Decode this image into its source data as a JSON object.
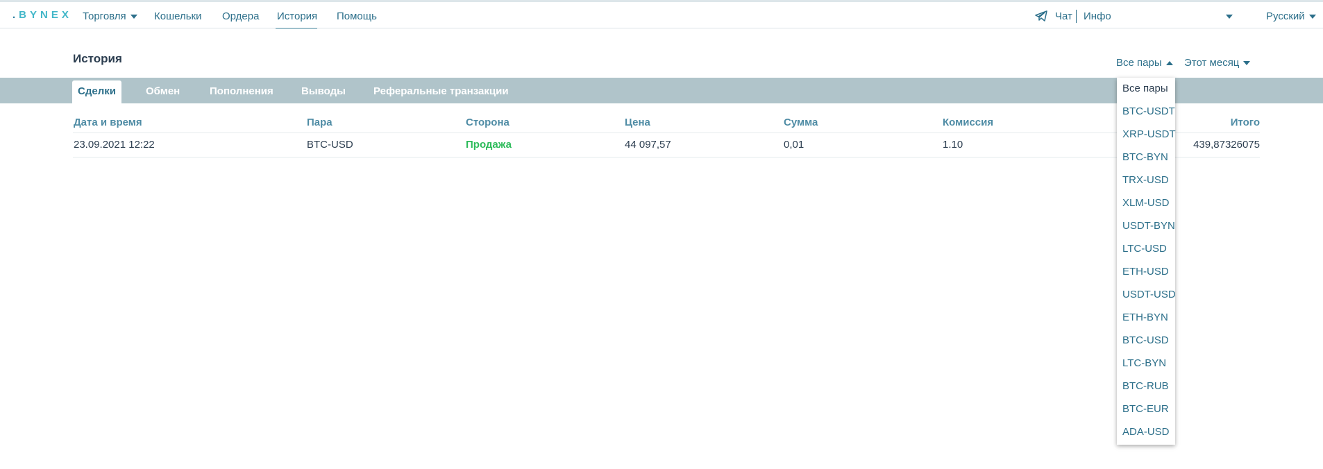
{
  "header": {
    "logo": "BYNEX",
    "nav": [
      "Торговля",
      "Кошельки",
      "Ордера",
      "История",
      "Помощь"
    ],
    "chat_label": "Чат",
    "info_label": "Инфо",
    "language": "Русский"
  },
  "page": {
    "title": "История",
    "pair_filter": "Все пары",
    "period_filter": "Этот месяц"
  },
  "tabs": [
    "Сделки",
    "Обмен",
    "Пополнения",
    "Выводы",
    "Реферальные транзакции"
  ],
  "table": {
    "columns": [
      "Дата и время",
      "Пара",
      "Сторона",
      "Цена",
      "Сумма",
      "Комиссия",
      "Итого"
    ],
    "rows": [
      [
        "23.09.2021 12:22",
        "BTC-USD",
        "Продажа",
        "44 097,57",
        "0,01",
        "1.10",
        "439,87326075"
      ]
    ]
  },
  "pair_dropdown": {
    "options": [
      "Все пары",
      "BTC-USDT",
      "XRP-USDT",
      "BTC-BYN",
      "TRX-USD",
      "XLM-USD",
      "USDT-BYN",
      "LTC-USD",
      "ETH-USD",
      "USDT-USD",
      "ETH-BYN",
      "BTC-USD",
      "LTC-BYN",
      "BTC-RUB",
      "BTC-EUR",
      "ADA-USD"
    ]
  },
  "colors": {
    "accent": "#2c6f8a",
    "tab_bar": "#b0c4ca",
    "sell": "#2dbb5a",
    "logo": "#43b7c9"
  }
}
